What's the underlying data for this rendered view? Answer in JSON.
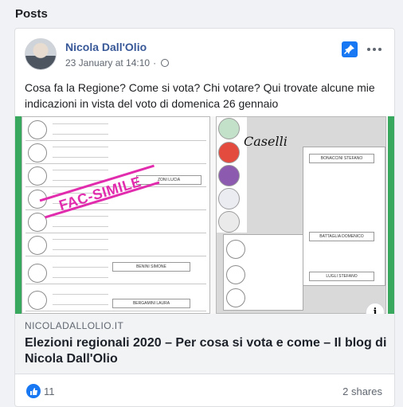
{
  "section": {
    "title": "Posts"
  },
  "post": {
    "author": "Nicola Dall'Olio",
    "date": "23 January at 14:10",
    "separator": "·",
    "text": "Cosa fa la Regione? Come si vota? Chi votare? Qui trovate alcune mie indicazioni in vista del voto di domenica 26 gennaio"
  },
  "media": {
    "watermark": "FAC-SIMILE",
    "handwriting": "Caselli",
    "candidates": [
      "ZONI LUCIA",
      "BENINI SIMONE",
      "BERGAMINI LAURA",
      "BONACCINI STEFANO",
      "BATTAGLIA DOMENICO",
      "LUGLI STEFANO"
    ],
    "info_label": "i"
  },
  "link": {
    "domain": "NICOLADALLOLIO.IT",
    "title": "Elezioni regionali 2020 – Per cosa si vota e come – Il blog di Nicola Dall'Olio"
  },
  "engagement": {
    "reaction_count": "11",
    "shares": "2 shares"
  },
  "icons": {
    "pin": "pin-icon",
    "globe": "globe-icon",
    "more": "more-options-icon",
    "like": "like-icon",
    "info": "info-icon"
  },
  "colors": {
    "link_blue": "#385898",
    "accent_blue": "#1877f2",
    "watermark_pink": "#e22cae",
    "ballot_green": "#38a85e"
  }
}
